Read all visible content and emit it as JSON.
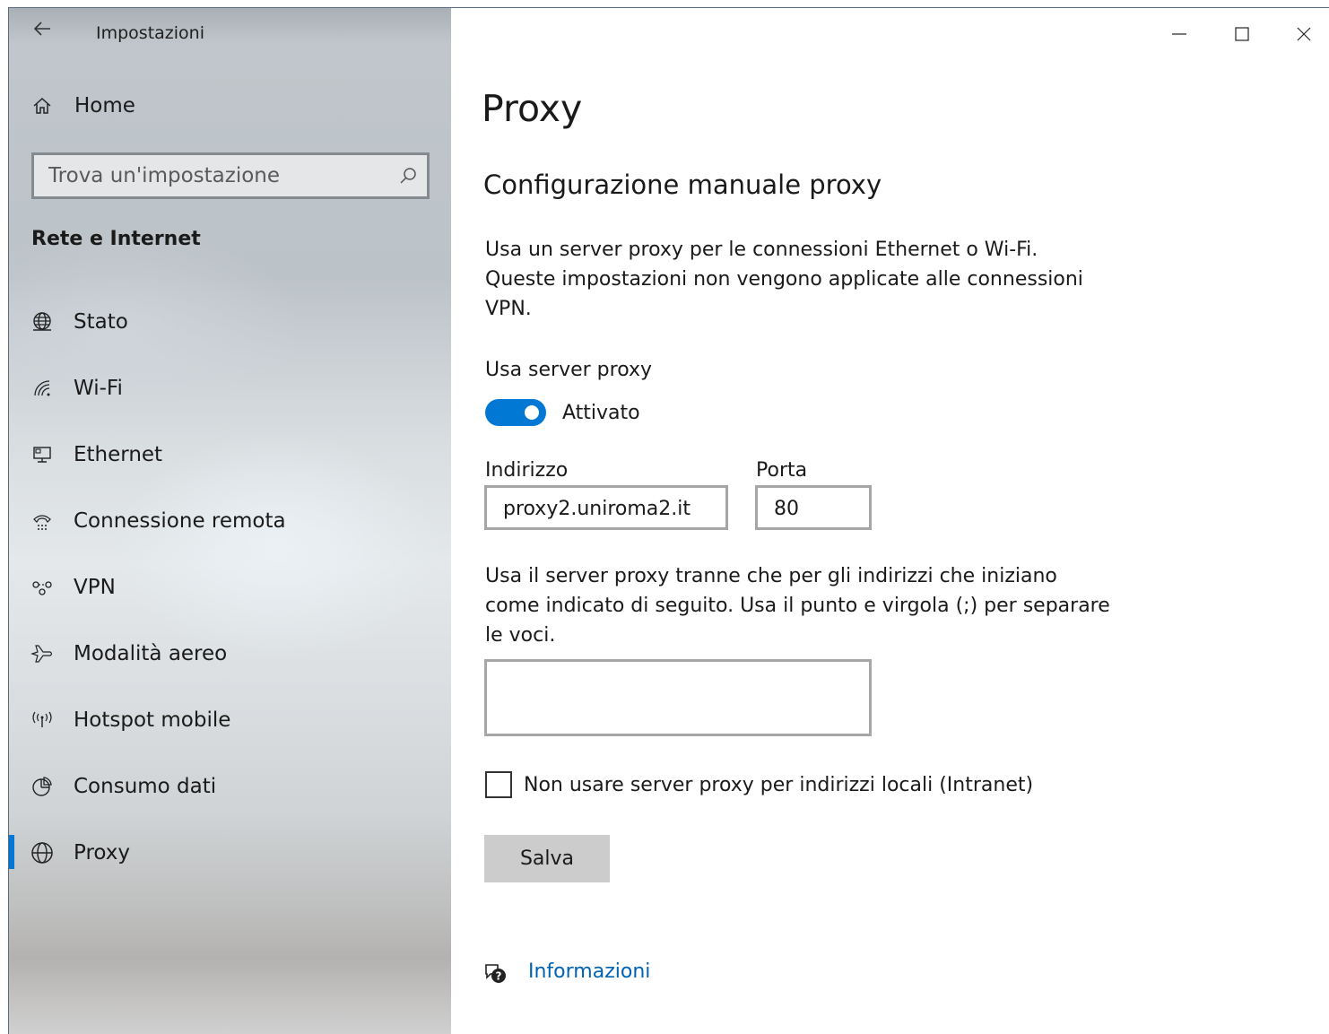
{
  "window": {
    "app_title": "Impostazioni",
    "controls": {
      "minimize": "minimize-icon",
      "maximize": "maximize-icon",
      "close": "close-icon"
    }
  },
  "sidebar": {
    "home_label": "Home",
    "search_placeholder": "Trova un'impostazione",
    "section_title": "Rete e Internet",
    "items": [
      {
        "label": "Stato",
        "icon": "globe-status-icon"
      },
      {
        "label": "Wi-Fi",
        "icon": "wifi-icon"
      },
      {
        "label": "Ethernet",
        "icon": "ethernet-icon"
      },
      {
        "label": "Connessione remota",
        "icon": "dialup-icon"
      },
      {
        "label": "VPN",
        "icon": "vpn-icon"
      },
      {
        "label": "Modalità aereo",
        "icon": "airplane-icon"
      },
      {
        "label": "Hotspot mobile",
        "icon": "hotspot-icon"
      },
      {
        "label": "Consumo dati",
        "icon": "data-usage-icon"
      },
      {
        "label": "Proxy",
        "icon": "globe-icon",
        "selected": true
      }
    ],
    "accent_color": "#0078d4"
  },
  "main": {
    "title": "Proxy",
    "subtitle": "Configurazione manuale proxy",
    "description": "Usa un server proxy per le connessioni Ethernet o Wi-Fi. Queste impostazioni non vengono applicate alle connessioni VPN.",
    "use_proxy_label": "Usa server proxy",
    "toggle_state": "Attivato",
    "toggle_on": true,
    "address_label": "Indirizzo",
    "address_value": "proxy2.uniroma2.it",
    "port_label": "Porta",
    "port_value": "80",
    "exceptions_description": "Usa il server proxy tranne che per gli indirizzi che iniziano come indicato di seguito. Usa il punto e virgola (;) per separare le voci.",
    "exceptions_value": "",
    "local_checkbox_label": "Non usare server proxy per indirizzi locali (Intranet)",
    "local_checkbox_checked": false,
    "save_label": "Salva",
    "info_link": "Informazioni"
  }
}
